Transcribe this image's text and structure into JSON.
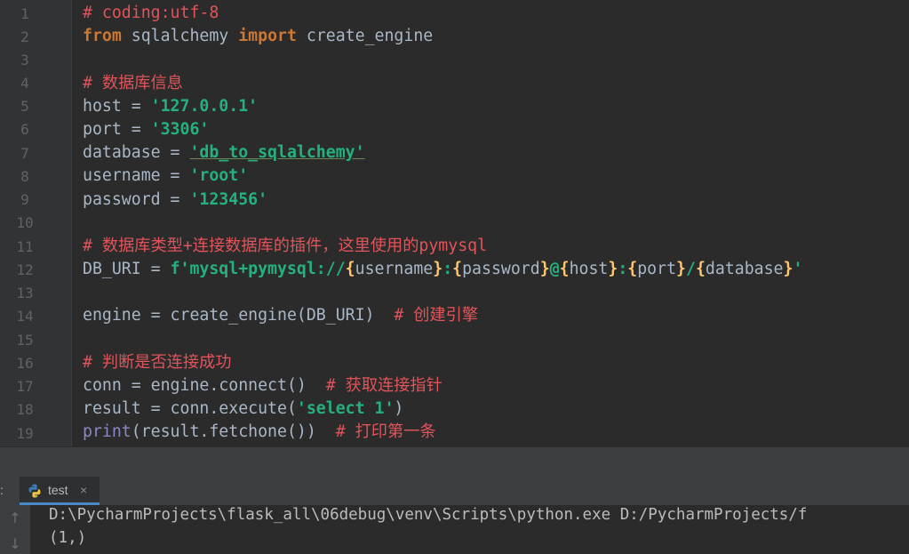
{
  "editor": {
    "line_numbers": [
      "1",
      "2",
      "3",
      "4",
      "5",
      "6",
      "7",
      "8",
      "9",
      "10",
      "11",
      "12",
      "13",
      "14",
      "15",
      "16",
      "17",
      "18",
      "19"
    ],
    "lines": {
      "l1": "# coding:utf-8",
      "l2_from": "from",
      "l2_mod": " sqlalchemy ",
      "l2_import": "import",
      "l2_name": " create_engine",
      "l4": "# 数据库信息",
      "l5_var": "host = ",
      "l5_val": "'127.0.0.1'",
      "l6_var": "port = ",
      "l6_val": "'3306'",
      "l7_var": "database = ",
      "l7_val": "'db_to_sqlalchemy'",
      "l8_var": "username = ",
      "l8_val": "'root'",
      "l9_var": "password = ",
      "l9_val": "'123456'",
      "l11": "# 数据库类型+连接数据库的插件，这里使用的pymysql",
      "l12_var": "DB_URI = ",
      "l12_p1": "f'mysql+pymysql://",
      "l12_o1": "{",
      "l12_v1": "username",
      "l12_c1": "}",
      "l12_s1": ":",
      "l12_o2": "{",
      "l12_v2": "password",
      "l12_c2": "}",
      "l12_s2": "@",
      "l12_o3": "{",
      "l12_v3": "host",
      "l12_c3": "}",
      "l12_s3": ":",
      "l12_o4": "{",
      "l12_v4": "port",
      "l12_c4": "}",
      "l12_s4": "/",
      "l12_o5": "{",
      "l12_v5": "database",
      "l12_c5": "}",
      "l12_end": "'",
      "l14_code": "engine = create_engine(DB_URI)  ",
      "l14_cmt": "# 创建引擎",
      "l16": "# 判断是否连接成功",
      "l17_code": "conn = engine.connect()  ",
      "l17_cmt": "# 获取连接指针",
      "l18_code": "result = conn.execute(",
      "l18_str": "'select 1'",
      "l18_end": ")",
      "l19_print": "print",
      "l19_code": "(result.fetchone())  ",
      "l19_cmt": "# 打印第一条"
    }
  },
  "run_panel": {
    "side_label": ":",
    "tab_label": "test",
    "tab_close": "×",
    "tab_icon": "python-icon",
    "toolbar": {
      "up_icon": "↑",
      "down_icon": "↓"
    },
    "console_lines": [
      "D:\\PycharmProjects\\flask_all\\06debug\\venv\\Scripts\\python.exe D:/PycharmProjects/f",
      "(1,)"
    ]
  },
  "colors": {
    "background": "#2b2b2b",
    "keyword": "#cc7832",
    "string": "#24b17e",
    "comment": "#e0545a",
    "text": "#a9b7c6",
    "brace": "#ffc66d",
    "builtin": "#8888c6"
  }
}
